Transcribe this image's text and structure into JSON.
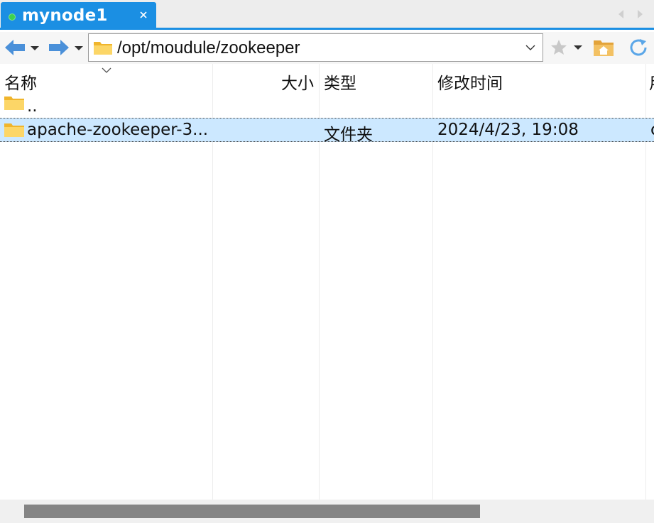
{
  "tab": {
    "label": "mynode1",
    "status_color": "#3dd24f",
    "accent": "#1b8fe3"
  },
  "toolbar": {
    "path": "/opt/moudule/zookeeper",
    "icons": [
      "back-arrow-icon",
      "dropdown-icon",
      "forward-arrow-icon",
      "dropdown-icon",
      "folder-icon",
      "chevron-down-icon",
      "star-icon",
      "home-folder-icon",
      "refresh-icon"
    ]
  },
  "columns": {
    "name": "名称",
    "size": "大小",
    "type": "类型",
    "modified": "修改时间",
    "extra": "用"
  },
  "rows": [
    {
      "name": "..",
      "size": "",
      "type": "",
      "modified": "",
      "extra": "",
      "selected": false
    },
    {
      "name": "apache-zookeeper-3...",
      "size": "",
      "type": "文件夹",
      "modified": "2024/4/23, 19:08",
      "extra": "c",
      "selected": true
    }
  ],
  "colors": {
    "selection": "#cce8ff",
    "folder": "#f7c948",
    "scroll_thumb": "#858585"
  }
}
